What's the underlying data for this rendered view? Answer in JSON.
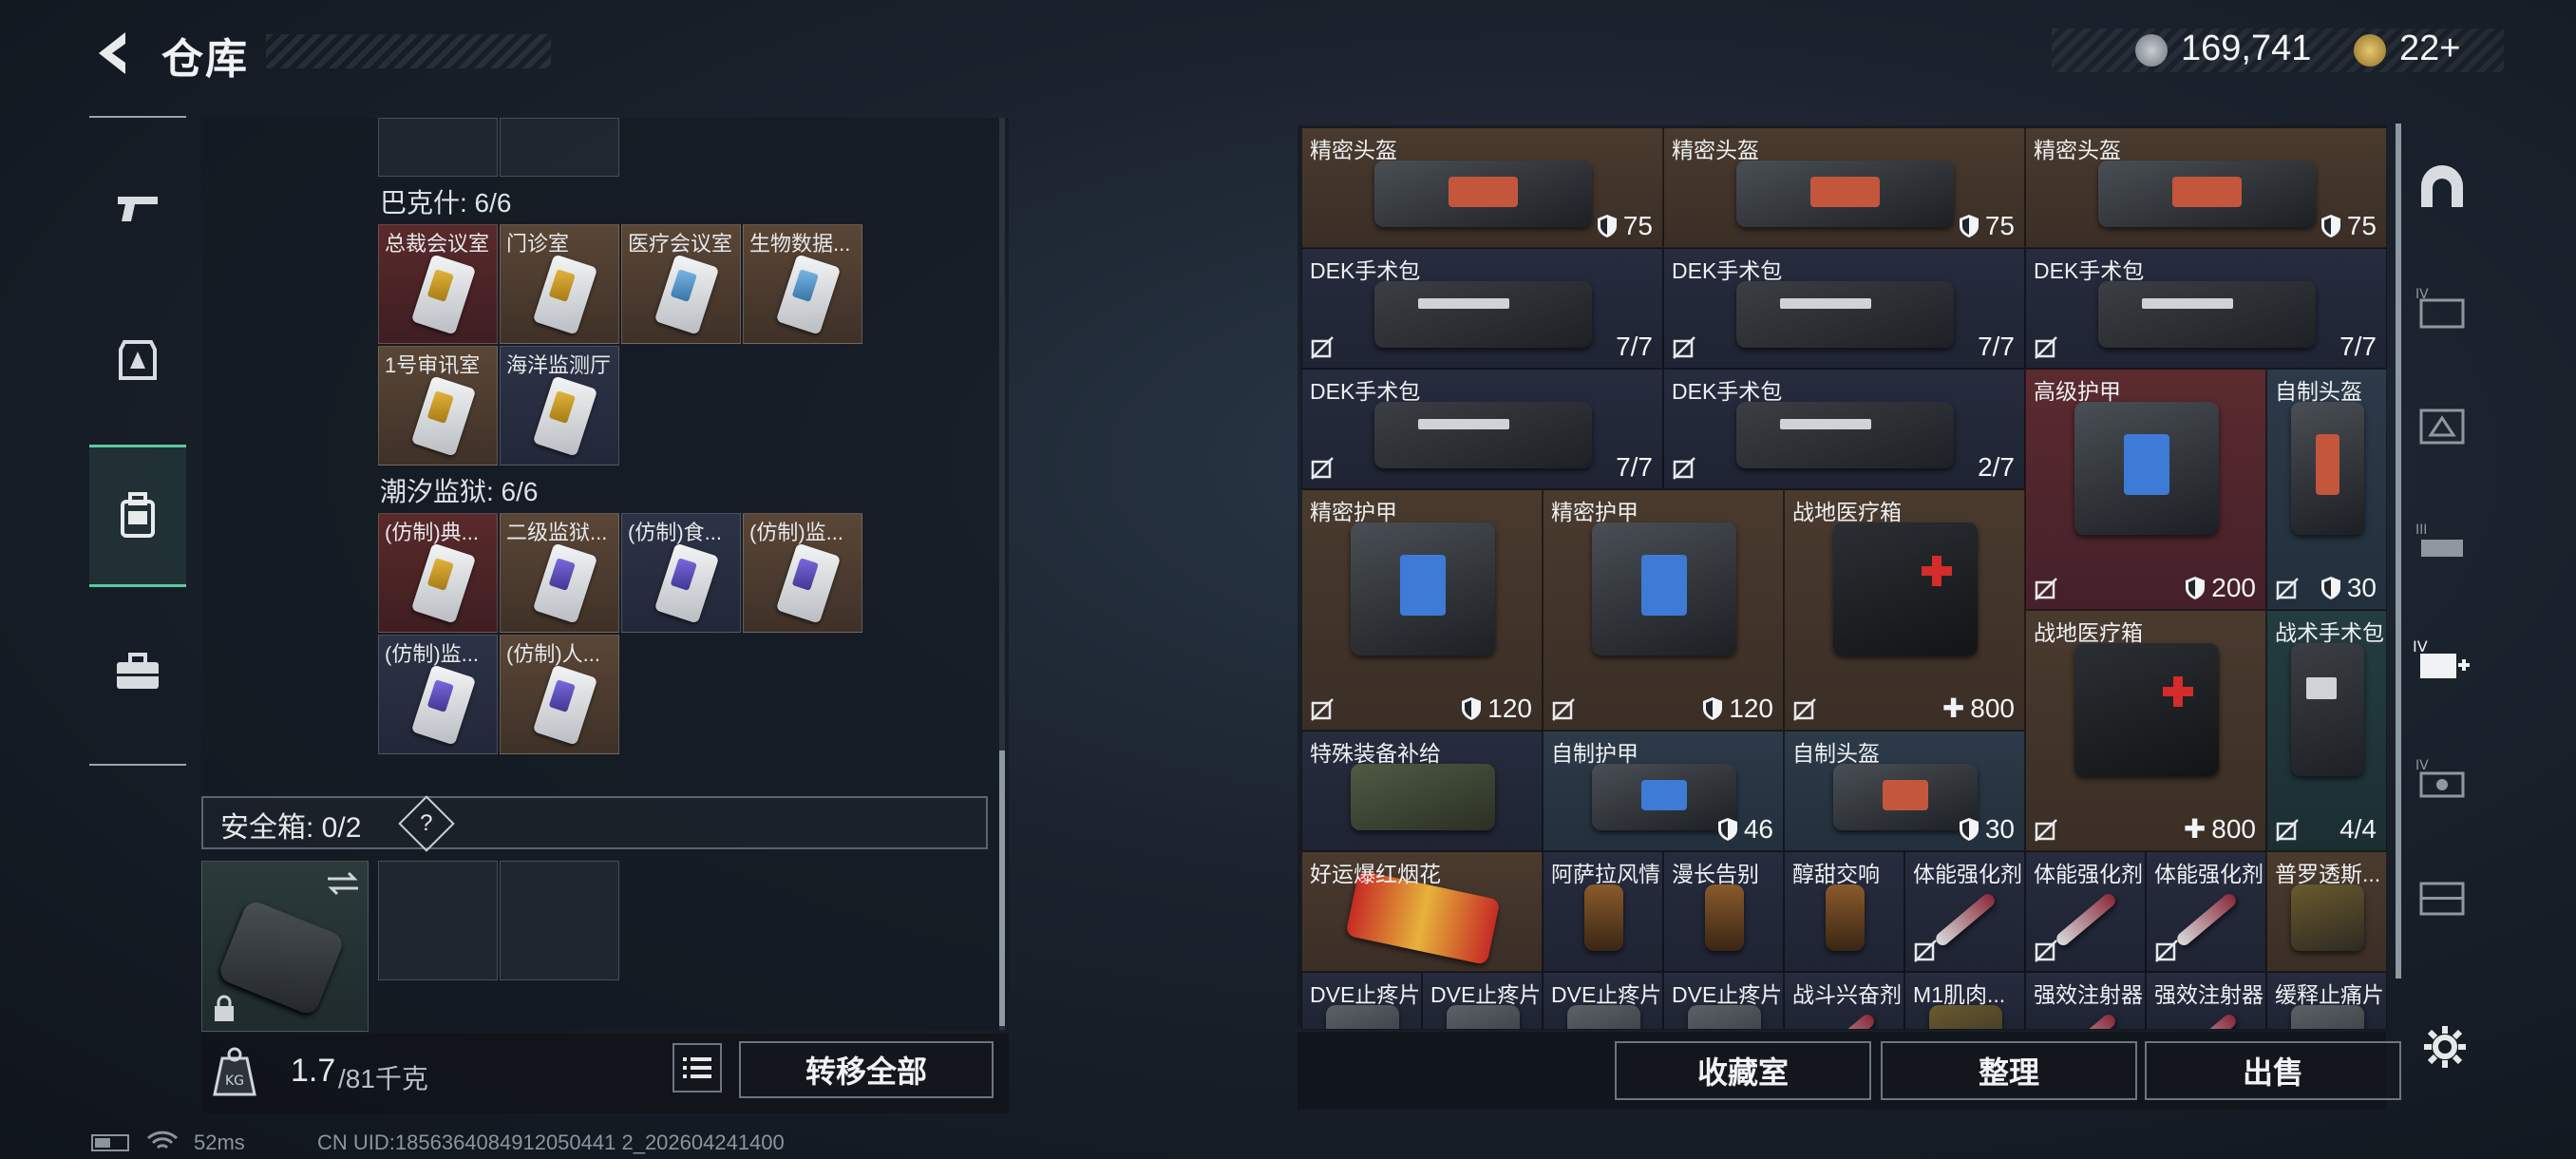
{
  "header": {
    "title": "仓库",
    "currency_primary": "169,741",
    "currency_secondary": "22+"
  },
  "left_nav": {
    "items": [
      {
        "name": "weapon",
        "icon": "gun-icon"
      },
      {
        "name": "equipment",
        "icon": "armor-icon"
      },
      {
        "name": "backpack",
        "icon": "backpack-icon",
        "active": true
      },
      {
        "name": "case",
        "icon": "briefcase-icon"
      }
    ]
  },
  "left_panel": {
    "sections": [
      {
        "title": "巴克什: 6/6",
        "cards": [
          {
            "label": "总裁会议室",
            "bg": "red",
            "accent": "gold"
          },
          {
            "label": "门诊室",
            "bg": "brown",
            "accent": "gold"
          },
          {
            "label": "医疗会议室",
            "bg": "brown",
            "accent": "blue"
          },
          {
            "label": "生物数据...",
            "bg": "brown",
            "accent": "blue"
          },
          {
            "label": "1号审讯室",
            "bg": "brown",
            "accent": "gold"
          },
          {
            "label": "海洋监测厅",
            "bg": "navy",
            "accent": "gold"
          }
        ]
      },
      {
        "title": "潮汐监狱: 6/6",
        "cards": [
          {
            "label": "(仿制)典...",
            "bg": "red",
            "accent": "gold"
          },
          {
            "label": "二级监狱...",
            "bg": "brown",
            "accent": "purple"
          },
          {
            "label": "(仿制)食...",
            "bg": "navy",
            "accent": "purple"
          },
          {
            "label": "(仿制)监...",
            "bg": "brown",
            "accent": "purple"
          },
          {
            "label": "(仿制)监...",
            "bg": "navy",
            "accent": "purple"
          },
          {
            "label": "(仿制)人...",
            "bg": "brown",
            "accent": "purple"
          }
        ]
      }
    ],
    "safebox": {
      "label": "安全箱: 0/2",
      "help": "?"
    },
    "weight": {
      "current": "1.7",
      "max": "/81千克"
    },
    "transfer_all": "转移全部"
  },
  "grid": [
    {
      "label": "精密头盔",
      "value": "75",
      "kind": "shield",
      "bg": "brown"
    },
    {
      "label": "精密头盔",
      "value": "75",
      "kind": "shield",
      "bg": "brown"
    },
    {
      "label": "精密头盔",
      "value": "75",
      "kind": "shield",
      "bg": "brown"
    },
    {
      "label": "DEK手术包",
      "value": "7/7",
      "kind": "count",
      "bg": "navy"
    },
    {
      "label": "DEK手术包",
      "value": "7/7",
      "kind": "count",
      "bg": "navy"
    },
    {
      "label": "DEK手术包",
      "value": "7/7",
      "kind": "count",
      "bg": "navy"
    },
    {
      "label": "DEK手术包",
      "value": "7/7",
      "kind": "count",
      "bg": "navy"
    },
    {
      "label": "DEK手术包",
      "value": "2/7",
      "kind": "count",
      "bg": "navy"
    },
    {
      "label": "高级护甲",
      "value": "200",
      "kind": "shield",
      "bg": "red"
    },
    {
      "label": "自制头盔",
      "value": "30",
      "kind": "shield",
      "bg": "steel"
    },
    {
      "label": "精密护甲",
      "value": "120",
      "kind": "shield",
      "bg": "brown"
    },
    {
      "label": "精密护甲",
      "value": "120",
      "kind": "shield",
      "bg": "brown"
    },
    {
      "label": "战地医疗箱",
      "value": "800",
      "kind": "heal",
      "bg": "brown"
    },
    {
      "label": "战地医疗箱",
      "value": "800",
      "kind": "heal",
      "bg": "brown"
    },
    {
      "label": "战术手术包",
      "value": "4/4",
      "kind": "count",
      "bg": "teal"
    },
    {
      "label": "特殊装备补给",
      "value": "",
      "kind": "none",
      "bg": "navy"
    },
    {
      "label": "自制护甲",
      "value": "46",
      "kind": "shield",
      "bg": "steel"
    },
    {
      "label": "自制头盔",
      "value": "30",
      "kind": "shield",
      "bg": "steel"
    },
    {
      "label": "好运爆红烟花",
      "value": "",
      "kind": "none",
      "bg": "brown"
    },
    {
      "label": "阿萨拉风情",
      "value": "",
      "kind": "none",
      "bg": "navy"
    },
    {
      "label": "漫长告别",
      "value": "",
      "kind": "none",
      "bg": "navy"
    },
    {
      "label": "醇甜交响",
      "value": "",
      "kind": "none",
      "bg": "navy"
    },
    {
      "label": "体能强化剂",
      "value": "",
      "kind": "none",
      "bg": "navy"
    },
    {
      "label": "体能强化剂",
      "value": "",
      "kind": "none",
      "bg": "navy"
    },
    {
      "label": "体能强化剂",
      "value": "",
      "kind": "none",
      "bg": "navy"
    },
    {
      "label": "普罗透斯...",
      "value": "",
      "kind": "none",
      "bg": "brown"
    },
    {
      "label": "DVE止疼片",
      "value": "",
      "kind": "none",
      "bg": "navy"
    },
    {
      "label": "DVE止疼片",
      "value": "",
      "kind": "none",
      "bg": "navy"
    },
    {
      "label": "DVE止疼片",
      "value": "",
      "kind": "none",
      "bg": "navy"
    },
    {
      "label": "DVE止疼片",
      "value": "",
      "kind": "none",
      "bg": "navy"
    },
    {
      "label": "战斗兴奋剂",
      "value": "",
      "kind": "none",
      "bg": "navy"
    },
    {
      "label": "M1肌肉...",
      "value": "",
      "kind": "none",
      "bg": "navy"
    },
    {
      "label": "强效注射器",
      "value": "",
      "kind": "none",
      "bg": "navy"
    },
    {
      "label": "强效注射器",
      "value": "",
      "kind": "none",
      "bg": "navy"
    },
    {
      "label": "缓释止痛片",
      "value": "",
      "kind": "none",
      "bg": "navy"
    }
  ],
  "bottom_actions": {
    "collection": "收藏室",
    "organize": "整理",
    "sell": "出售"
  },
  "status_bar": {
    "ping": "52ms",
    "uid": "CN UID:1856364084912050441 2_202604241400"
  },
  "colors": {
    "accent_active": "#5ec9a0",
    "cell_brown": "#4a3a2e",
    "cell_red": "#5b2b2f",
    "cell_navy": "#262c3e"
  }
}
